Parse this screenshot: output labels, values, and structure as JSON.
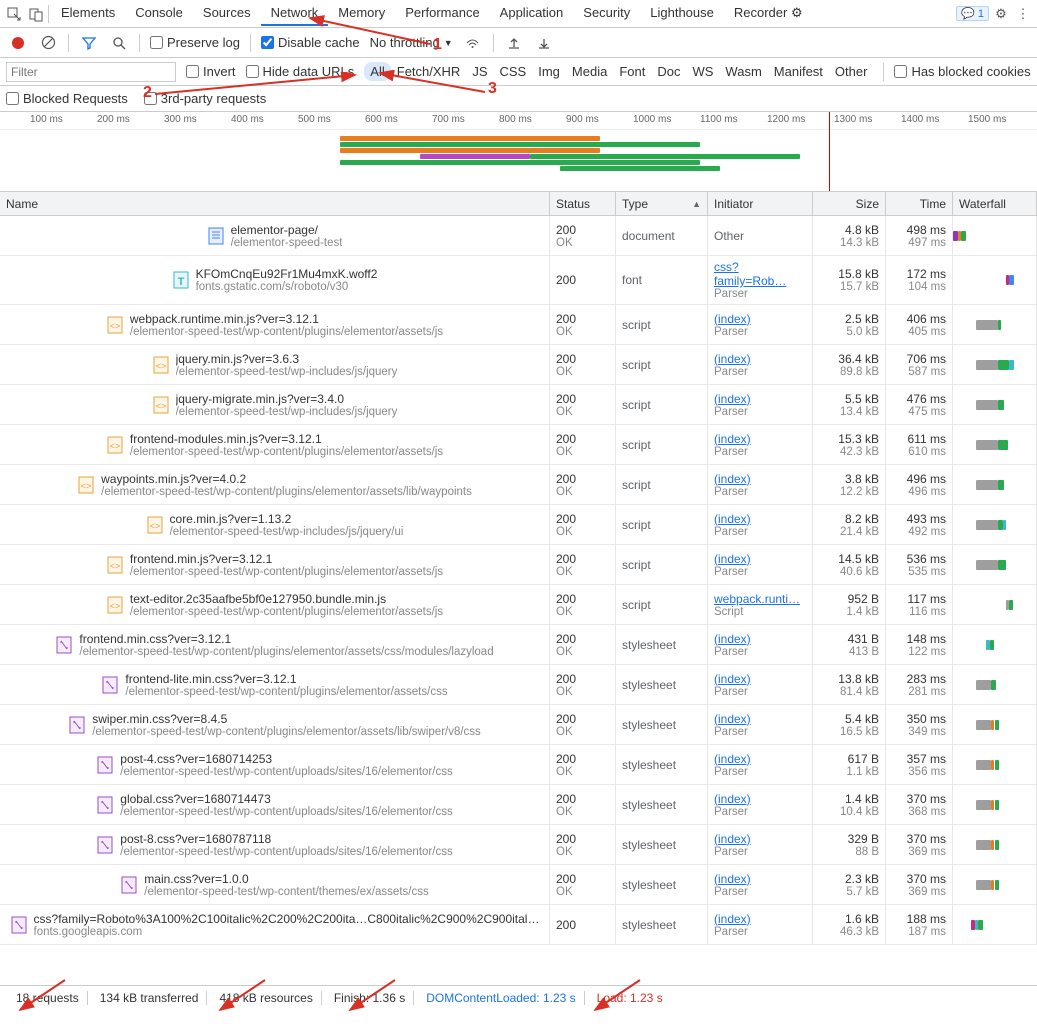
{
  "tabs": [
    "Elements",
    "Console",
    "Sources",
    "Network",
    "Memory",
    "Performance",
    "Application",
    "Security",
    "Lighthouse",
    "Recorder ⚙"
  ],
  "active_tab": "Network",
  "badge_count": "1",
  "net_toolbar": {
    "preserve_log": "Preserve log",
    "disable_cache": "Disable cache",
    "throttling": "No throttling"
  },
  "filter": {
    "placeholder": "Filter",
    "invert": "Invert",
    "hide_data_urls": "Hide data URLs",
    "types": [
      "All",
      "Fetch/XHR",
      "JS",
      "CSS",
      "Img",
      "Media",
      "Font",
      "Doc",
      "WS",
      "Wasm",
      "Manifest",
      "Other"
    ],
    "active_type": "All",
    "blocked_cookies": "Has blocked cookies",
    "blocked_requests": "Blocked Requests",
    "third_party": "3rd-party requests"
  },
  "ticks": [
    "100 ms",
    "200 ms",
    "300 ms",
    "400 ms",
    "500 ms",
    "600 ms",
    "700 ms",
    "800 ms",
    "900 ms",
    "1000 ms",
    "1100 ms",
    "1200 ms",
    "1300 ms",
    "1400 ms",
    "1500 ms"
  ],
  "headers": {
    "name": "Name",
    "status": "Status",
    "type": "Type",
    "initiator": "Initiator",
    "size": "Size",
    "time": "Time",
    "waterfall": "Waterfall"
  },
  "rows": [
    {
      "icon": "doc",
      "name": "elementor-page/",
      "path": "/elementor-speed-test",
      "st": "200",
      "stx": "OK",
      "type": "document",
      "init": "Other",
      "initLink": false,
      "initSub": "",
      "s1": "4.8 kB",
      "s2": "14.3 kB",
      "t1": "498 ms",
      "t2": "497 ms",
      "wf": [
        [
          "#8a3ab9",
          0,
          6
        ],
        [
          "#e87c1e",
          6,
          4
        ],
        [
          "#29aa4f",
          10,
          6
        ]
      ]
    },
    {
      "icon": "font",
      "name": "KFOmCnqEu92Fr1Mu4mxK.woff2",
      "path": "fonts.gstatic.com/s/roboto/v30",
      "st": "200",
      "stx": "",
      "type": "font",
      "init": "css?family=Rob…",
      "initLink": true,
      "initSub": "Parser",
      "s1": "15.8 kB",
      "s2": "15.7 kB",
      "t1": "172 ms",
      "t2": "104 ms",
      "wf": [
        [
          "#cb2a7b",
          64,
          4
        ],
        [
          "#4285f4",
          68,
          6
        ]
      ]
    },
    {
      "icon": "js",
      "name": "webpack.runtime.min.js?ver=3.12.1",
      "path": "/elementor-speed-test/wp-content/plugins/elementor/assets/js",
      "st": "200",
      "stx": "OK",
      "type": "script",
      "init": "(index)",
      "initLink": true,
      "initSub": "Parser",
      "s1": "2.5 kB",
      "s2": "5.0 kB",
      "t1": "406 ms",
      "t2": "405 ms",
      "wf": [
        [
          "#9e9e9e",
          28,
          26
        ],
        [
          "#29aa4f",
          54,
          4
        ]
      ]
    },
    {
      "icon": "js",
      "name": "jquery.min.js?ver=3.6.3",
      "path": "/elementor-speed-test/wp-includes/js/jquery",
      "st": "200",
      "stx": "OK",
      "type": "script",
      "init": "(index)",
      "initLink": true,
      "initSub": "Parser",
      "s1": "36.4 kB",
      "s2": "89.8 kB",
      "t1": "706 ms",
      "t2": "587 ms",
      "wf": [
        [
          "#9e9e9e",
          28,
          26
        ],
        [
          "#29aa4f",
          54,
          14
        ],
        [
          "#3cb8c8",
          68,
          6
        ]
      ]
    },
    {
      "icon": "js",
      "name": "jquery-migrate.min.js?ver=3.4.0",
      "path": "/elementor-speed-test/wp-includes/js/jquery",
      "st": "200",
      "stx": "OK",
      "type": "script",
      "init": "(index)",
      "initLink": true,
      "initSub": "Parser",
      "s1": "5.5 kB",
      "s2": "13.4 kB",
      "t1": "476 ms",
      "t2": "475 ms",
      "wf": [
        [
          "#9e9e9e",
          28,
          26
        ],
        [
          "#29aa4f",
          54,
          8
        ]
      ]
    },
    {
      "icon": "js",
      "name": "frontend-modules.min.js?ver=3.12.1",
      "path": "/elementor-speed-test/wp-content/plugins/elementor/assets/js",
      "st": "200",
      "stx": "OK",
      "type": "script",
      "init": "(index)",
      "initLink": true,
      "initSub": "Parser",
      "s1": "15.3 kB",
      "s2": "42.3 kB",
      "t1": "611 ms",
      "t2": "610 ms",
      "wf": [
        [
          "#9e9e9e",
          28,
          26
        ],
        [
          "#29aa4f",
          54,
          12
        ]
      ]
    },
    {
      "icon": "js",
      "name": "waypoints.min.js?ver=4.0.2",
      "path": "/elementor-speed-test/wp-content/plugins/elementor/assets/lib/waypoints",
      "st": "200",
      "stx": "OK",
      "type": "script",
      "init": "(index)",
      "initLink": true,
      "initSub": "Parser",
      "s1": "3.8 kB",
      "s2": "12.2 kB",
      "t1": "496 ms",
      "t2": "496 ms",
      "wf": [
        [
          "#9e9e9e",
          28,
          26
        ],
        [
          "#29aa4f",
          54,
          8
        ]
      ]
    },
    {
      "icon": "js",
      "name": "core.min.js?ver=1.13.2",
      "path": "/elementor-speed-test/wp-includes/js/jquery/ui",
      "st": "200",
      "stx": "OK",
      "type": "script",
      "init": "(index)",
      "initLink": true,
      "initSub": "Parser",
      "s1": "8.2 kB",
      "s2": "21.4 kB",
      "t1": "493 ms",
      "t2": "492 ms",
      "wf": [
        [
          "#9e9e9e",
          28,
          26
        ],
        [
          "#29aa4f",
          54,
          6
        ],
        [
          "#3cb8c8",
          60,
          4
        ]
      ]
    },
    {
      "icon": "js",
      "name": "frontend.min.js?ver=3.12.1",
      "path": "/elementor-speed-test/wp-content/plugins/elementor/assets/js",
      "st": "200",
      "stx": "OK",
      "type": "script",
      "init": "(index)",
      "initLink": true,
      "initSub": "Parser",
      "s1": "14.5 kB",
      "s2": "40.6 kB",
      "t1": "536 ms",
      "t2": "535 ms",
      "wf": [
        [
          "#9e9e9e",
          28,
          26
        ],
        [
          "#29aa4f",
          54,
          10
        ]
      ]
    },
    {
      "icon": "js",
      "name": "text-editor.2c35aafbe5bf0e127950.bundle.min.js",
      "path": "/elementor-speed-test/wp-content/plugins/elementor/assets/js",
      "st": "200",
      "stx": "OK",
      "type": "script",
      "init": "webpack.runti…",
      "initLink": true,
      "initSub": "Script",
      "s1": "952 B",
      "s2": "1.4 kB",
      "t1": "117 ms",
      "t2": "116 ms",
      "wf": [
        [
          "#9e9e9e",
          64,
          4
        ],
        [
          "#29aa4f",
          68,
          4
        ]
      ]
    },
    {
      "icon": "css",
      "name": "frontend.min.css?ver=3.12.1",
      "path": "/elementor-speed-test/wp-content/plugins/elementor/assets/css/modules/lazyload",
      "st": "200",
      "stx": "OK",
      "type": "stylesheet",
      "init": "(index)",
      "initLink": true,
      "initSub": "Parser",
      "s1": "431 B",
      "s2": "413 B",
      "t1": "148 ms",
      "t2": "122 ms",
      "wf": [
        [
          "#3cb8c8",
          40,
          4
        ],
        [
          "#29aa4f",
          44,
          6
        ]
      ]
    },
    {
      "icon": "css",
      "name": "frontend-lite.min.css?ver=3.12.1",
      "path": "/elementor-speed-test/wp-content/plugins/elementor/assets/css",
      "st": "200",
      "stx": "OK",
      "type": "stylesheet",
      "init": "(index)",
      "initLink": true,
      "initSub": "Parser",
      "s1": "13.8 kB",
      "s2": "81.4 kB",
      "t1": "283 ms",
      "t2": "281 ms",
      "wf": [
        [
          "#9e9e9e",
          28,
          18
        ],
        [
          "#29aa4f",
          46,
          6
        ]
      ]
    },
    {
      "icon": "css",
      "name": "swiper.min.css?ver=8.4.5",
      "path": "/elementor-speed-test/wp-content/plugins/elementor/assets/lib/swiper/v8/css",
      "st": "200",
      "stx": "OK",
      "type": "stylesheet",
      "init": "(index)",
      "initLink": true,
      "initSub": "Parser",
      "s1": "5.4 kB",
      "s2": "16.5 kB",
      "t1": "350 ms",
      "t2": "349 ms",
      "wf": [
        [
          "#9e9e9e",
          28,
          18
        ],
        [
          "#e87c1e",
          46,
          4
        ],
        [
          "#29aa4f",
          50,
          6
        ]
      ]
    },
    {
      "icon": "css",
      "name": "post-4.css?ver=1680714253",
      "path": "/elementor-speed-test/wp-content/uploads/sites/16/elementor/css",
      "st": "200",
      "stx": "OK",
      "type": "stylesheet",
      "init": "(index)",
      "initLink": true,
      "initSub": "Parser",
      "s1": "617 B",
      "s2": "1.1 kB",
      "t1": "357 ms",
      "t2": "356 ms",
      "wf": [
        [
          "#9e9e9e",
          28,
          18
        ],
        [
          "#e87c1e",
          46,
          4
        ],
        [
          "#29aa4f",
          50,
          6
        ]
      ]
    },
    {
      "icon": "css",
      "name": "global.css?ver=1680714473",
      "path": "/elementor-speed-test/wp-content/uploads/sites/16/elementor/css",
      "st": "200",
      "stx": "OK",
      "type": "stylesheet",
      "init": "(index)",
      "initLink": true,
      "initSub": "Parser",
      "s1": "1.4 kB",
      "s2": "10.4 kB",
      "t1": "370 ms",
      "t2": "368 ms",
      "wf": [
        [
          "#9e9e9e",
          28,
          18
        ],
        [
          "#e87c1e",
          46,
          4
        ],
        [
          "#29aa4f",
          50,
          6
        ]
      ]
    },
    {
      "icon": "css",
      "name": "post-8.css?ver=1680787118",
      "path": "/elementor-speed-test/wp-content/uploads/sites/16/elementor/css",
      "st": "200",
      "stx": "OK",
      "type": "stylesheet",
      "init": "(index)",
      "initLink": true,
      "initSub": "Parser",
      "s1": "329 B",
      "s2": "88 B",
      "t1": "370 ms",
      "t2": "369 ms",
      "wf": [
        [
          "#9e9e9e",
          28,
          18
        ],
        [
          "#e87c1e",
          46,
          4
        ],
        [
          "#29aa4f",
          50,
          6
        ]
      ]
    },
    {
      "icon": "css",
      "name": "main.css?ver=1.0.0",
      "path": "/elementor-speed-test/wp-content/themes/ex/assets/css",
      "st": "200",
      "stx": "OK",
      "type": "stylesheet",
      "init": "(index)",
      "initLink": true,
      "initSub": "Parser",
      "s1": "2.3 kB",
      "s2": "5.7 kB",
      "t1": "370 ms",
      "t2": "369 ms",
      "wf": [
        [
          "#9e9e9e",
          28,
          18
        ],
        [
          "#e87c1e",
          46,
          4
        ],
        [
          "#29aa4f",
          50,
          6
        ]
      ]
    },
    {
      "icon": "css",
      "name": "css?family=Roboto%3A100%2C100italic%2C200%2C200ita…C800italic%2C900%2C900ital…",
      "path": "fonts.googleapis.com",
      "st": "200",
      "stx": "",
      "type": "stylesheet",
      "init": "(index)",
      "initLink": true,
      "initSub": "Parser",
      "s1": "1.6 kB",
      "s2": "46.3 kB",
      "t1": "188 ms",
      "t2": "187 ms",
      "wf": [
        [
          "#cb2a7b",
          22,
          4
        ],
        [
          "#3cb8c8",
          26,
          4
        ],
        [
          "#29aa4f",
          30,
          6
        ]
      ]
    }
  ],
  "status": {
    "requests": "18 requests",
    "transferred": "134 kB transferred",
    "resources": "418 kB resources",
    "finish": "Finish: 1.36 s",
    "dom": "DOMContentLoaded: 1.23 s",
    "load": "Load: 1.23 s"
  },
  "annotations": {
    "a1": "1",
    "a2": "2",
    "a3": "3"
  }
}
